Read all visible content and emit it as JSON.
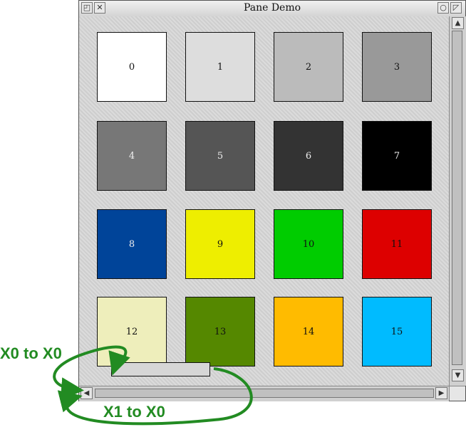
{
  "window": {
    "title": "Pane Demo",
    "titlebar_icons": [
      "back-icon",
      "close-icon",
      "iconise-icon",
      "toggle-size-icon"
    ]
  },
  "swatches": [
    {
      "label": "0",
      "color": "#ffffff",
      "text_color": "#111111"
    },
    {
      "label": "1",
      "color": "#dddddd",
      "text_color": "#111111"
    },
    {
      "label": "2",
      "color": "#bbbbbb",
      "text_color": "#111111"
    },
    {
      "label": "3",
      "color": "#999999",
      "text_color": "#111111"
    },
    {
      "label": "4",
      "color": "#777777",
      "text_color": "#eeeeee"
    },
    {
      "label": "5",
      "color": "#555555",
      "text_color": "#eeeeee"
    },
    {
      "label": "6",
      "color": "#333333",
      "text_color": "#eeeeee"
    },
    {
      "label": "7",
      "color": "#000000",
      "text_color": "#eeeeee"
    },
    {
      "label": "8",
      "color": "#004499",
      "text_color": "#eeeeee"
    },
    {
      "label": "9",
      "color": "#eeee00",
      "text_color": "#111111"
    },
    {
      "label": "10",
      "color": "#00cc00",
      "text_color": "#111111"
    },
    {
      "label": "11",
      "color": "#dd0000",
      "text_color": "#111111"
    },
    {
      "label": "12",
      "color": "#eeeebb",
      "text_color": "#111111"
    },
    {
      "label": "13",
      "color": "#558800",
      "text_color": "#111111"
    },
    {
      "label": "14",
      "color": "#ffbb00",
      "text_color": "#111111"
    },
    {
      "label": "15",
      "color": "#00bbff",
      "text_color": "#111111"
    }
  ],
  "annotations": {
    "top_label": "X0 to X0",
    "bottom_label": "X1 to X0",
    "color": "#228b22"
  }
}
